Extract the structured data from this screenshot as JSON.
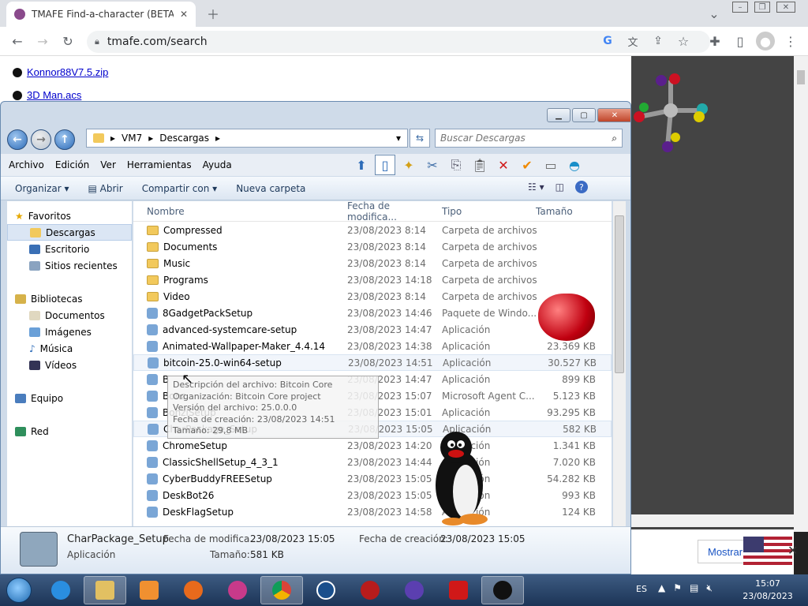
{
  "browser": {
    "tab_title": "TMAFE Find-a-character (BETA)",
    "url": "tmafe.com/search"
  },
  "page": {
    "links": [
      "Konnor88V7.5.zip",
      "3D Man.acs"
    ],
    "show_button": "Mostrar"
  },
  "explorer": {
    "breadcrumb": [
      "VM7",
      "Descargas"
    ],
    "search_placeholder": "Buscar Descargas",
    "menu": [
      "Archivo",
      "Edición",
      "Ver",
      "Herramientas",
      "Ayuda"
    ],
    "commands": [
      "Organizar",
      "Abrir",
      "Compartir con",
      "Nueva carpeta"
    ],
    "nav": {
      "favoritos": "Favoritos",
      "fav_items": [
        "Descargas",
        "Escritorio",
        "Sitios recientes"
      ],
      "bibliotecas": "Bibliotecas",
      "lib_items": [
        "Documentos",
        "Imágenes",
        "Música",
        "Vídeos"
      ],
      "equipo": "Equipo",
      "red": "Red"
    },
    "columns": [
      "Nombre",
      "Fecha de modifica...",
      "Tipo",
      "Tamaño"
    ],
    "files": [
      {
        "name": "Compressed",
        "date": "23/08/2023 8:14",
        "type": "Carpeta de archivos",
        "size": "",
        "kind": "folder"
      },
      {
        "name": "Documents",
        "date": "23/08/2023 8:14",
        "type": "Carpeta de archivos",
        "size": "",
        "kind": "folder"
      },
      {
        "name": "Music",
        "date": "23/08/2023 8:14",
        "type": "Carpeta de archivos",
        "size": "",
        "kind": "folder"
      },
      {
        "name": "Programs",
        "date": "23/08/2023 14:18",
        "type": "Carpeta de archivos",
        "size": "",
        "kind": "folder"
      },
      {
        "name": "Video",
        "date": "23/08/2023 8:14",
        "type": "Carpeta de archivos",
        "size": "",
        "kind": "folder"
      },
      {
        "name": "8GadgetPackSetup",
        "date": "23/08/2023 14:46",
        "type": "Paquete de Windo...",
        "size": "",
        "kind": "app"
      },
      {
        "name": "advanced-systemcare-setup",
        "date": "23/08/2023 14:47",
        "type": "Aplicación",
        "size": "",
        "kind": "app"
      },
      {
        "name": "Animated-Wallpaper-Maker_4.4.14",
        "date": "23/08/2023 14:38",
        "type": "Aplicación",
        "size": "23.369 KB",
        "kind": "app"
      },
      {
        "name": "bitcoin-25.0-win64-setup",
        "date": "23/08/2023 14:51",
        "type": "Aplicación",
        "size": "30.527 KB",
        "kind": "app"
      },
      {
        "name": "B",
        "date": "23/08/2023 14:47",
        "type": "Aplicación",
        "size": "899 KB",
        "kind": "app"
      },
      {
        "name": "Bonz",
        "date": "23/08/2023 15:07",
        "type": "Microsoft Agent C...",
        "size": "5.123 KB",
        "kind": "app"
      },
      {
        "name": "BonziSetup",
        "date": "23/08/2023 15:01",
        "type": "Aplicación",
        "size": "93.295 KB",
        "kind": "app"
      },
      {
        "name": "CharPackage_Setup",
        "date": "23/08/2023 15:05",
        "type": "Aplicación",
        "size": "582 KB",
        "kind": "app"
      },
      {
        "name": "ChromeSetup",
        "date": "23/08/2023 14:20",
        "type": "Aplicación",
        "size": "1.341 KB",
        "kind": "app"
      },
      {
        "name": "ClassicShellSetup_4_3_1",
        "date": "23/08/2023 14:44",
        "type": "Aplicación",
        "size": "7.020 KB",
        "kind": "app"
      },
      {
        "name": "CyberBuddyFREESetup",
        "date": "23/08/2023 15:05",
        "type": "Aplicación",
        "size": "54.282 KB",
        "kind": "app"
      },
      {
        "name": "DeskBot26",
        "date": "23/08/2023 15:05",
        "type": "Aplicación",
        "size": "993 KB",
        "kind": "app"
      },
      {
        "name": "DeskFlagSetup",
        "date": "23/08/2023 14:58",
        "type": "Aplicación",
        "size": "124 KB",
        "kind": "app"
      }
    ],
    "tooltip": [
      "Descripción del archivo: Bitcoin Core",
      "Organización: Bitcoin Core project",
      "Versión del archivo: 25.0.0.0",
      "Fecha de creación: 23/08/2023 14:51",
      "Tamaño: 29,8 MB"
    ],
    "details": {
      "name": "CharPackage_Setup",
      "kind": "Aplicación",
      "mod_label": "Fecha de modifica...",
      "mod_value": "23/08/2023 15:05",
      "size_label": "Tamaño:",
      "size_value": "581 KB",
      "created_label": "Fecha de creación:",
      "created_value": "23/08/2023 15:05"
    }
  },
  "taskbar": {
    "lang": "ES",
    "time": "15:07",
    "date": "23/08/2023"
  }
}
